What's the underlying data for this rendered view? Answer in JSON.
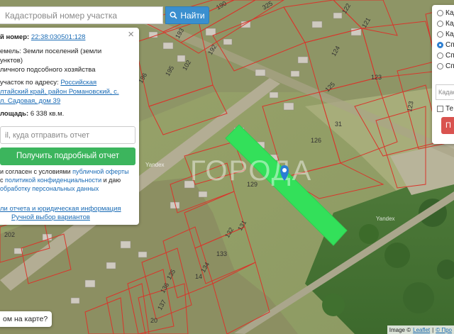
{
  "search": {
    "placeholder": "Кадастровый номер участка",
    "button_label": "Найти"
  },
  "info": {
    "cadastral_label": "й номер:",
    "cadastral_value": "22:38:030501:128",
    "category_line1": "емель: Земли поселений (земли",
    "category_line2": "унктов)",
    "category_line3": "личного подсобного хозяйства",
    "address_label": "участок по адресу:",
    "address_line1": "Российская",
    "address_line2": "лтайский край, район Романовский, с.",
    "address_line3": "л. Садовая, дом 39",
    "area_label": "лощадь:",
    "area_value": "6 338 кв.м.",
    "email_placeholder": "il, куда отправить отчет",
    "report_button": "Получить подробный отчет",
    "terms_line1_a": "и согласен с условиями",
    "terms_line1_link": "публичной оферты",
    "terms_line2_a": "с",
    "terms_line2_link": "политикой конфиденциальности",
    "terms_line2_b": "и даю",
    "terms_line3_link": "обработку персональных данных",
    "sample_link": "ли отчета и юридическая информация",
    "manual_link": "Ручной выбор вариантов"
  },
  "layers": {
    "options": [
      "Кад",
      "Кад",
      "Кад",
      "Сп",
      "Сп",
      "Сп"
    ],
    "selected_index": 3,
    "input_placeholder": "Кадаст",
    "checkbox_label": "Те",
    "button_label": "П"
  },
  "question": "ом на карте?",
  "watermark": "ГОРОДА",
  "yandex_marks": [
    "Yandex",
    "Yandex"
  ],
  "attribution": {
    "image": "Image ©",
    "leaflet": "Leaflet",
    "sep": "|",
    "suffix": "© Про"
  },
  "parcel_labels": [
    "190",
    "325",
    "122",
    "121",
    "193",
    "192",
    "196",
    "195",
    "102",
    "124",
    "123",
    "125",
    "126",
    "31",
    "123",
    "129",
    "131",
    "132",
    "133",
    "134",
    "135",
    "14",
    "136",
    "137",
    "202",
    "20"
  ],
  "colors": {
    "highlight": "#33e05a",
    "parcel_line": "#d9352b",
    "button_blue": "#3a8fcf",
    "button_green": "#3cb55d",
    "button_red": "#d9534f",
    "marker": "#2a7fd4"
  }
}
